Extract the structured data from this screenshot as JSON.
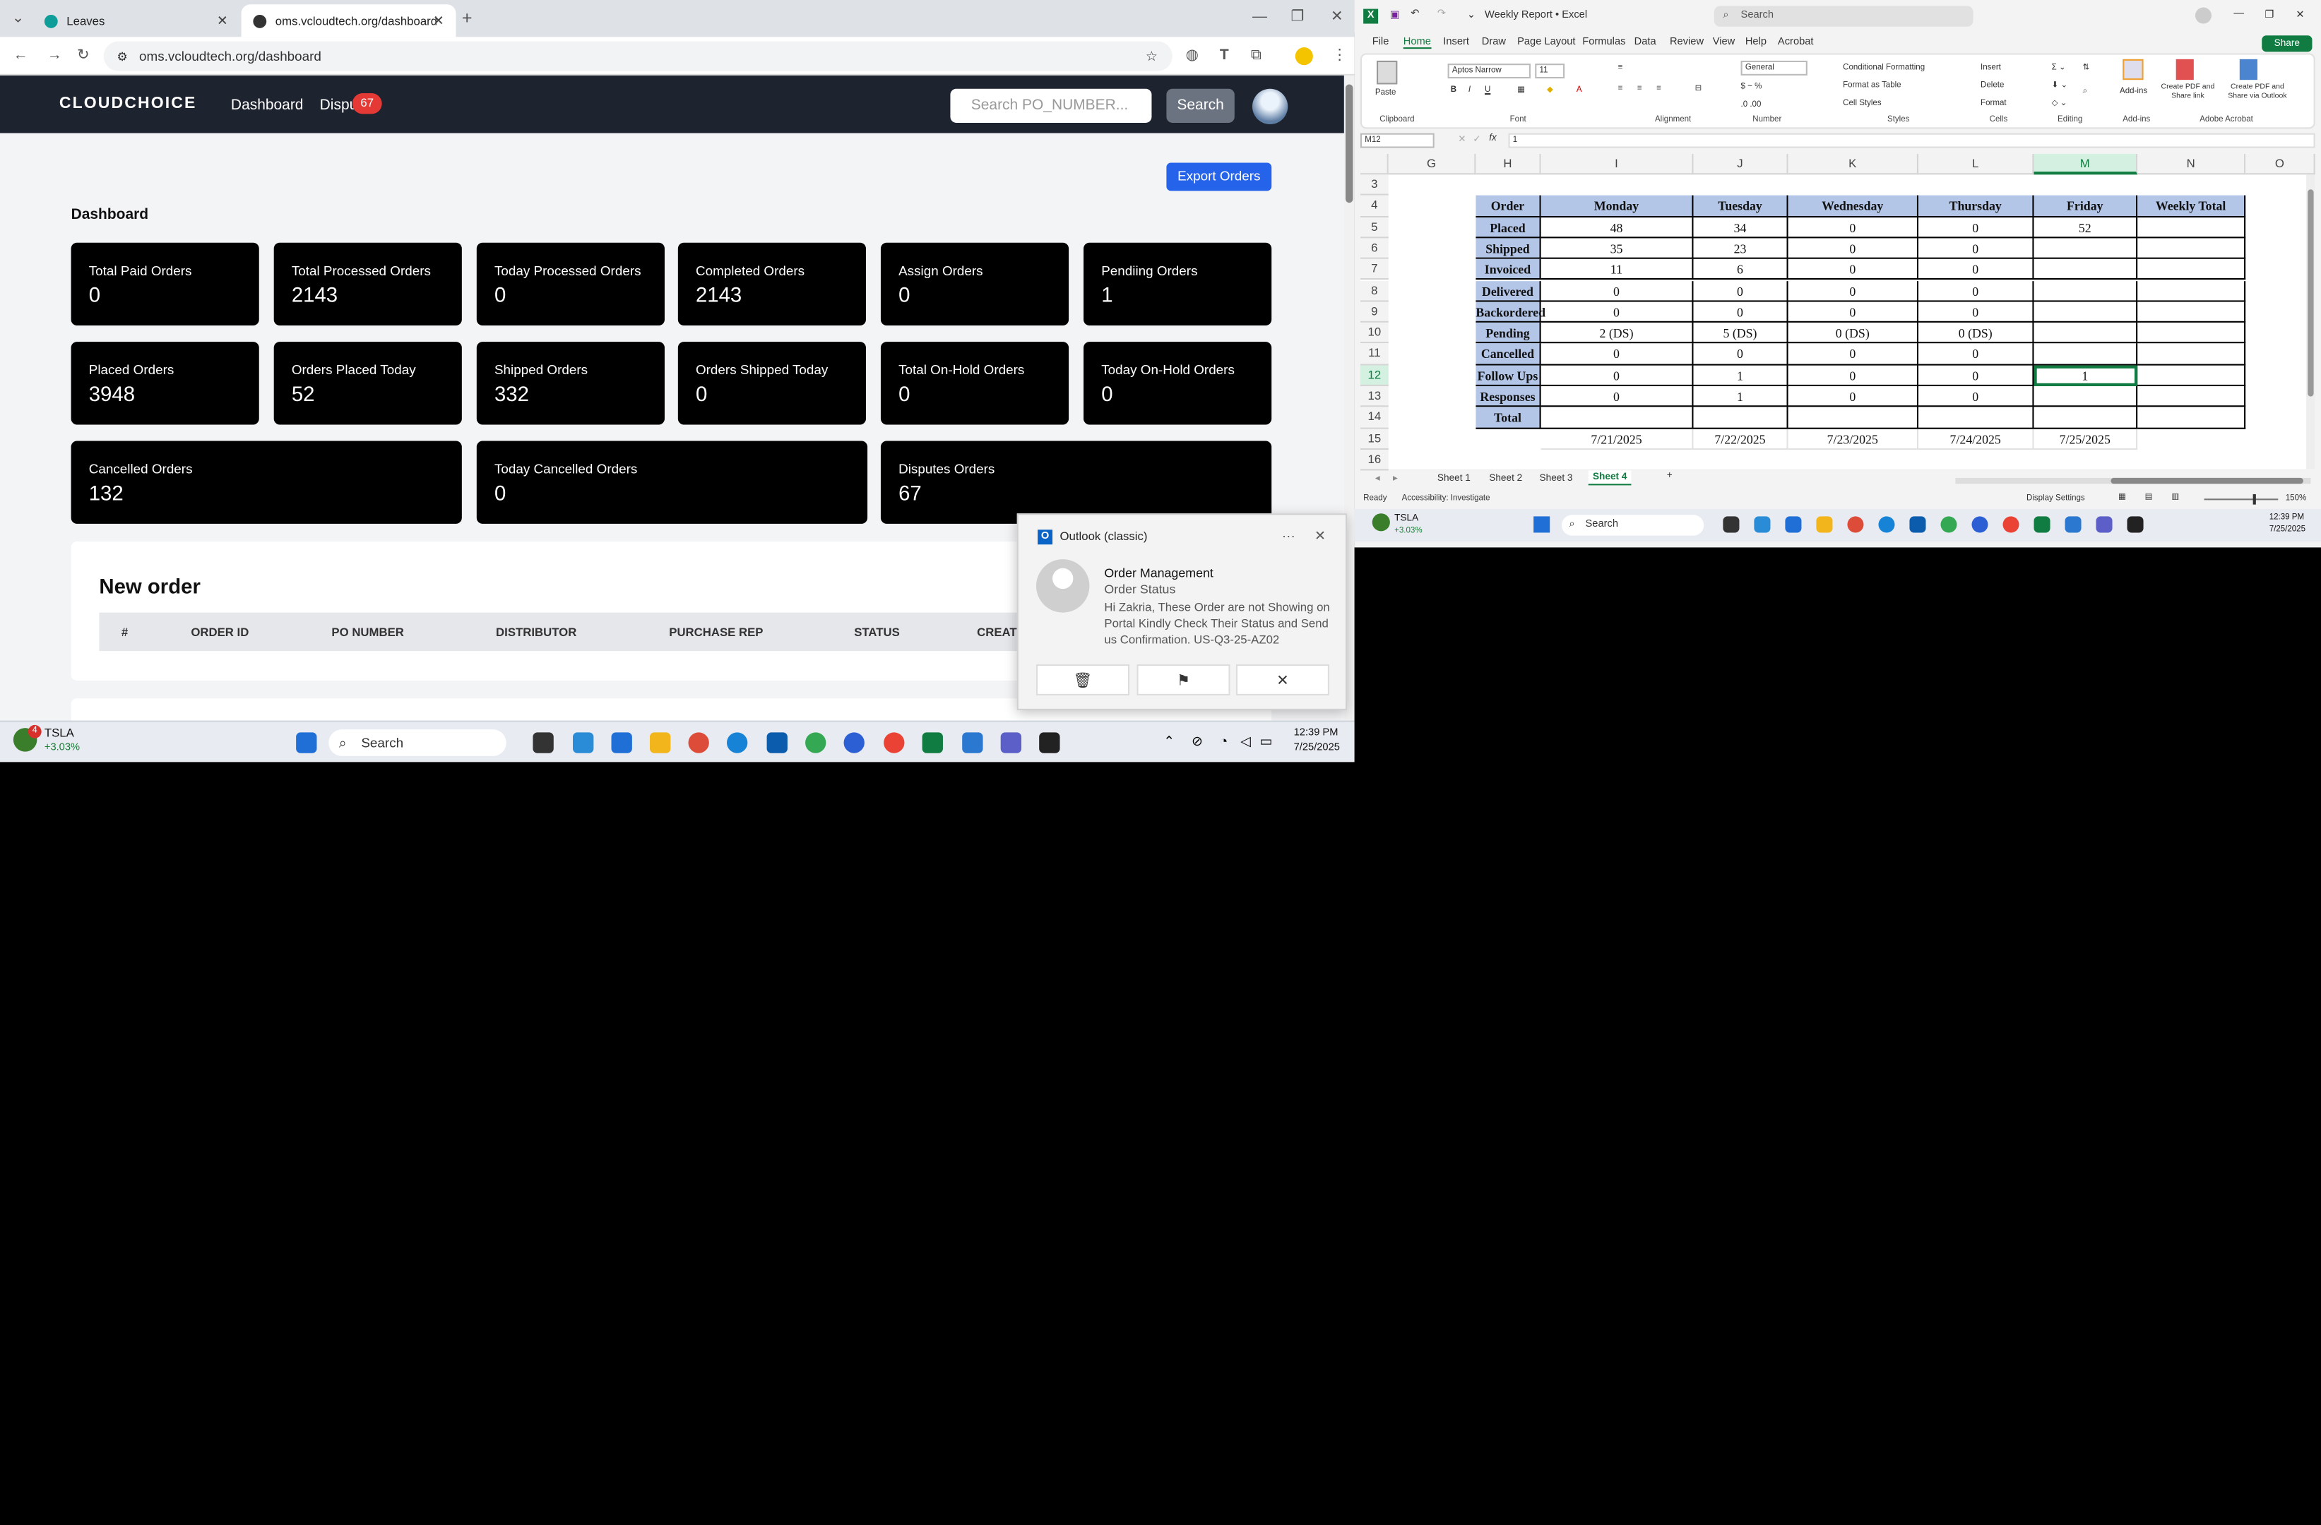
{
  "browser": {
    "tabs": [
      {
        "title": "Leaves"
      },
      {
        "title": "oms.vcloudtech.org/dashboard"
      }
    ],
    "url": "oms.vcloudtech.org/dashboard"
  },
  "app": {
    "logo": "CLOUDCHOICE",
    "nav": [
      "Dashboard",
      "Dispu"
    ],
    "badge": "67",
    "search_placeholder": "Search PO_NUMBER...",
    "search_button": "Search",
    "export_button": "Export Orders",
    "dashboard_title": "Dashboard",
    "cards": [
      {
        "label": "Total Paid Orders",
        "value": "0"
      },
      {
        "label": "Total Processed Orders",
        "value": "2143"
      },
      {
        "label": "Today Processed Orders",
        "value": "0"
      },
      {
        "label": "Completed Orders",
        "value": "2143"
      },
      {
        "label": "Assign Orders",
        "value": "0"
      },
      {
        "label": "Pendiing Orders",
        "value": "1"
      },
      {
        "label": "Placed Orders",
        "value": "3948"
      },
      {
        "label": "Orders Placed Today",
        "value": "52"
      },
      {
        "label": "Shipped Orders",
        "value": "332"
      },
      {
        "label": "Orders Shipped Today",
        "value": "0"
      },
      {
        "label": "Total On-Hold Orders",
        "value": "0"
      },
      {
        "label": "Today On-Hold Orders",
        "value": "0"
      },
      {
        "label": "Cancelled Orders",
        "value": "132"
      },
      {
        "label": "Today Cancelled Orders",
        "value": "0"
      },
      {
        "label": "Disputes Orders",
        "value": "67"
      }
    ],
    "new_order": {
      "title": "New order",
      "columns": [
        "#",
        "ORDER ID",
        "PO NUMBER",
        "DISTRIBUTOR",
        "PURCHASE REP",
        "STATUS",
        "CREAT"
      ]
    }
  },
  "notification": {
    "app": "Outlook (classic)",
    "title": "Order Management",
    "subject": "Order Status",
    "body": "Hi Zakria,  These Order are not Showing on Portal  Kindly Check Their Status and Send us Confirmation.   US-Q3-25-AZ02",
    "actions": [
      "delete-icon",
      "flag-icon",
      "close-icon"
    ]
  },
  "taskbar_left": {
    "stock": "TSLA",
    "change": "+3.03%",
    "stock_badge": "4",
    "search": "Search",
    "time": "12:39 PM",
    "date": "7/25/2025"
  },
  "excel": {
    "title": "Weekly Report  •  Excel",
    "search": "Search",
    "menus": [
      "File",
      "Home",
      "Insert",
      "Draw",
      "Page Layout",
      "Formulas",
      "Data",
      "Review",
      "View",
      "Help",
      "Acrobat"
    ],
    "share": "Share",
    "ribbon": {
      "font": "Aptos Narrow",
      "size": "11",
      "format": "General",
      "groups": [
        "Clipboard",
        "Font",
        "Alignment",
        "Number",
        "Styles",
        "Cells",
        "Editing",
        "Add-ins",
        "Adobe Acrobat"
      ],
      "items": [
        "Paste",
        "Conditional Formatting",
        "Format as Table",
        "Cell Styles",
        "Insert",
        "Delete",
        "Format",
        "Add-ins",
        "Create PDF and Share link",
        "Create PDF and Share via Outlook"
      ]
    },
    "name_box": "M12",
    "formula_value": "1",
    "columns": [
      "G",
      "H",
      "I",
      "J",
      "K",
      "L",
      "M",
      "N",
      "O"
    ],
    "rows": [
      "3",
      "4",
      "5",
      "6",
      "7",
      "8",
      "9",
      "10",
      "11",
      "12",
      "13",
      "14",
      "15",
      "16"
    ],
    "table": {
      "headers": [
        "Order Status",
        "Monday",
        "Tuesday",
        "Wednesday",
        "Thursday",
        "Friday",
        "Weekly Total"
      ],
      "rows": [
        [
          "Placed",
          "48",
          "34",
          "0",
          "0",
          "52",
          ""
        ],
        [
          "Shipped",
          "35",
          "23",
          "0",
          "0",
          "",
          ""
        ],
        [
          "Invoiced",
          "11",
          "6",
          "0",
          "0",
          "",
          ""
        ],
        [
          "Delivered",
          "0",
          "0",
          "0",
          "0",
          "",
          ""
        ],
        [
          "Backordered",
          "0",
          "0",
          "0",
          "0",
          "",
          ""
        ],
        [
          "Pending",
          "2 (DS)",
          "5 (DS)",
          "0 (DS)",
          "0 (DS)",
          "",
          ""
        ],
        [
          "Cancelled",
          "0",
          "0",
          "0",
          "0",
          "",
          ""
        ],
        [
          "Follow Ups",
          "0",
          "1",
          "0",
          "0",
          "1",
          ""
        ],
        [
          "Responses",
          "0",
          "1",
          "0",
          "0",
          "",
          ""
        ],
        [
          "Total",
          "",
          "",
          "",
          "",
          "",
          ""
        ]
      ],
      "dates": [
        "7/21/2025",
        "7/22/2025",
        "7/23/2025",
        "7/24/2025",
        "7/25/2025"
      ]
    },
    "sheets": [
      "Sheet 1",
      "Sheet 2",
      "Sheet 3",
      "Sheet 4"
    ],
    "active_sheet": "Sheet 4",
    "status_ready": "Ready",
    "status_access": "Accessibility: Investigate",
    "display_settings": "Display Settings",
    "zoom": "150%"
  },
  "taskbar_right": {
    "stock": "TSLA",
    "change": "+3.03%",
    "search": "Search",
    "time": "12:39 PM",
    "date": "7/25/2025"
  }
}
